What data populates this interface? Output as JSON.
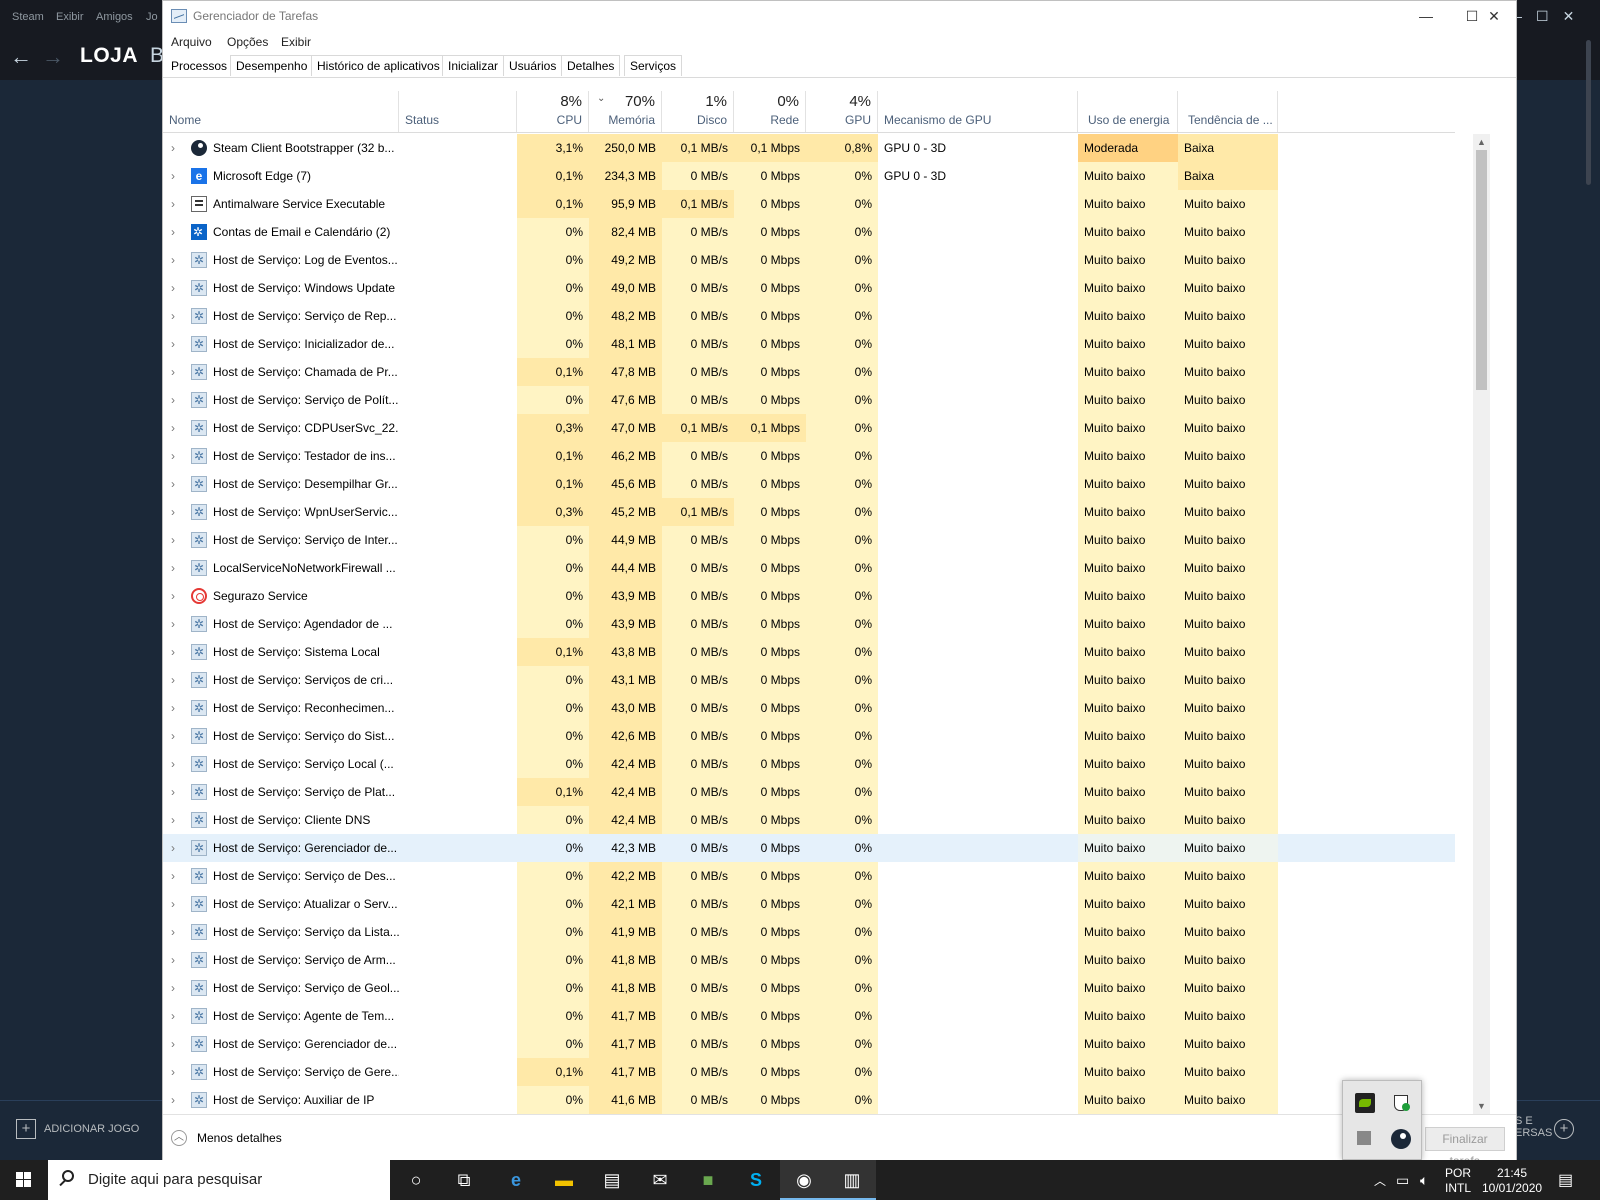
{
  "steam": {
    "menu": [
      "Steam",
      "Exibir",
      "Amigos",
      "Jo"
    ],
    "store_label": "LOJA",
    "store_next": "B",
    "add_game": "ADICIONAR JOGO",
    "friends_line1": "S E",
    "friends_line2": "ERSAS"
  },
  "taskmanager": {
    "title": "Gerenciador de Tarefas",
    "menu": [
      "Arquivo",
      "Opções",
      "Exibir"
    ],
    "tabs": [
      "Processos",
      "Desempenho",
      "Histórico de aplicativos",
      "Inicializar",
      "Usuários",
      "Detalhes",
      "Serviços"
    ],
    "active_tab": "Processos",
    "columns": {
      "name": "Nome",
      "status": "Status",
      "cpu": {
        "pct": "8%",
        "label": "CPU"
      },
      "memory": {
        "pct": "70%",
        "label": "Memória"
      },
      "disk": {
        "pct": "1%",
        "label": "Disco"
      },
      "network": {
        "pct": "0%",
        "label": "Rede"
      },
      "gpu": {
        "pct": "4%",
        "label": "GPU"
      },
      "gpu_engine": "Mecanismo de GPU",
      "power": "Uso de energia",
      "power_trend": "Tendência de ..."
    },
    "sorted_column": "Memória",
    "rows": [
      {
        "icon": "steam-icon",
        "name": "Steam Client Bootstrapper (32 b...",
        "cpu": "3,1%",
        "mem": "250,0 MB",
        "disk": "0,1 MB/s",
        "net": "0,1 Mbps",
        "gpu": "0,8%",
        "engine": "GPU 0 - 3D",
        "power": "Moderada",
        "trend": "Baixa"
      },
      {
        "icon": "edge-icon",
        "name": "Microsoft Edge (7)",
        "cpu": "0,1%",
        "mem": "234,3 MB",
        "disk": "0 MB/s",
        "net": "0 Mbps",
        "gpu": "0%",
        "engine": "GPU 0 - 3D",
        "power": "Muito baixo",
        "trend": "Baixa"
      },
      {
        "icon": "defender-icon",
        "name": "Antimalware Service Executable",
        "cpu": "0,1%",
        "mem": "95,9 MB",
        "disk": "0,1 MB/s",
        "net": "0 Mbps",
        "gpu": "0%",
        "engine": "",
        "power": "Muito baixo",
        "trend": "Muito baixo"
      },
      {
        "icon": "mail-icon",
        "name": "Contas de Email e Calendário (2)",
        "cpu": "0%",
        "mem": "82,4 MB",
        "disk": "0 MB/s",
        "net": "0 Mbps",
        "gpu": "0%",
        "engine": "",
        "power": "Muito baixo",
        "trend": "Muito baixo"
      },
      {
        "icon": "gear-icon",
        "name": "Host de Serviço: Log de Eventos...",
        "cpu": "0%",
        "mem": "49,2 MB",
        "disk": "0 MB/s",
        "net": "0 Mbps",
        "gpu": "0%",
        "engine": "",
        "power": "Muito baixo",
        "trend": "Muito baixo"
      },
      {
        "icon": "gear-icon",
        "name": "Host de Serviço: Windows Update",
        "cpu": "0%",
        "mem": "49,0 MB",
        "disk": "0 MB/s",
        "net": "0 Mbps",
        "gpu": "0%",
        "engine": "",
        "power": "Muito baixo",
        "trend": "Muito baixo"
      },
      {
        "icon": "gear-icon",
        "name": "Host de Serviço: Serviço de Rep...",
        "cpu": "0%",
        "mem": "48,2 MB",
        "disk": "0 MB/s",
        "net": "0 Mbps",
        "gpu": "0%",
        "engine": "",
        "power": "Muito baixo",
        "trend": "Muito baixo"
      },
      {
        "icon": "gear-icon",
        "name": "Host de Serviço: Inicializador de...",
        "cpu": "0%",
        "mem": "48,1 MB",
        "disk": "0 MB/s",
        "net": "0 Mbps",
        "gpu": "0%",
        "engine": "",
        "power": "Muito baixo",
        "trend": "Muito baixo"
      },
      {
        "icon": "gear-icon",
        "name": "Host de Serviço: Chamada de Pr...",
        "cpu": "0,1%",
        "mem": "47,8 MB",
        "disk": "0 MB/s",
        "net": "0 Mbps",
        "gpu": "0%",
        "engine": "",
        "power": "Muito baixo",
        "trend": "Muito baixo"
      },
      {
        "icon": "gear-icon",
        "name": "Host de Serviço: Serviço de Polít...",
        "cpu": "0%",
        "mem": "47,6 MB",
        "disk": "0 MB/s",
        "net": "0 Mbps",
        "gpu": "0%",
        "engine": "",
        "power": "Muito baixo",
        "trend": "Muito baixo"
      },
      {
        "icon": "gear-icon",
        "name": "Host de Serviço: CDPUserSvc_22...",
        "cpu": "0,3%",
        "mem": "47,0 MB",
        "disk": "0,1 MB/s",
        "net": "0,1 Mbps",
        "gpu": "0%",
        "engine": "",
        "power": "Muito baixo",
        "trend": "Muito baixo"
      },
      {
        "icon": "gear-icon",
        "name": "Host de Serviço: Testador de ins...",
        "cpu": "0,1%",
        "mem": "46,2 MB",
        "disk": "0 MB/s",
        "net": "0 Mbps",
        "gpu": "0%",
        "engine": "",
        "power": "Muito baixo",
        "trend": "Muito baixo"
      },
      {
        "icon": "gear-icon",
        "name": "Host de Serviço: Desempilhar Gr...",
        "cpu": "0,1%",
        "mem": "45,6 MB",
        "disk": "0 MB/s",
        "net": "0 Mbps",
        "gpu": "0%",
        "engine": "",
        "power": "Muito baixo",
        "trend": "Muito baixo"
      },
      {
        "icon": "gear-icon",
        "name": "Host de Serviço: WpnUserServic...",
        "cpu": "0,3%",
        "mem": "45,2 MB",
        "disk": "0,1 MB/s",
        "net": "0 Mbps",
        "gpu": "0%",
        "engine": "",
        "power": "Muito baixo",
        "trend": "Muito baixo"
      },
      {
        "icon": "gear-icon",
        "name": "Host de Serviço: Serviço de Inter...",
        "cpu": "0%",
        "mem": "44,9 MB",
        "disk": "0 MB/s",
        "net": "0 Mbps",
        "gpu": "0%",
        "engine": "",
        "power": "Muito baixo",
        "trend": "Muito baixo"
      },
      {
        "icon": "gear-icon",
        "name": "LocalServiceNoNetworkFirewall ...",
        "cpu": "0%",
        "mem": "44,4 MB",
        "disk": "0 MB/s",
        "net": "0 Mbps",
        "gpu": "0%",
        "engine": "",
        "power": "Muito baixo",
        "trend": "Muito baixo"
      },
      {
        "icon": "segurazo-icon",
        "name": "Segurazo Service",
        "cpu": "0%",
        "mem": "43,9 MB",
        "disk": "0 MB/s",
        "net": "0 Mbps",
        "gpu": "0%",
        "engine": "",
        "power": "Muito baixo",
        "trend": "Muito baixo"
      },
      {
        "icon": "gear-icon",
        "name": "Host de Serviço: Agendador de ...",
        "cpu": "0%",
        "mem": "43,9 MB",
        "disk": "0 MB/s",
        "net": "0 Mbps",
        "gpu": "0%",
        "engine": "",
        "power": "Muito baixo",
        "trend": "Muito baixo"
      },
      {
        "icon": "gear-icon",
        "name": "Host de Serviço: Sistema Local",
        "cpu": "0,1%",
        "mem": "43,8 MB",
        "disk": "0 MB/s",
        "net": "0 Mbps",
        "gpu": "0%",
        "engine": "",
        "power": "Muito baixo",
        "trend": "Muito baixo"
      },
      {
        "icon": "gear-icon",
        "name": "Host de Serviço: Serviços de cri...",
        "cpu": "0%",
        "mem": "43,1 MB",
        "disk": "0 MB/s",
        "net": "0 Mbps",
        "gpu": "0%",
        "engine": "",
        "power": "Muito baixo",
        "trend": "Muito baixo"
      },
      {
        "icon": "gear-icon",
        "name": "Host de Serviço: Reconhecimen...",
        "cpu": "0%",
        "mem": "43,0 MB",
        "disk": "0 MB/s",
        "net": "0 Mbps",
        "gpu": "0%",
        "engine": "",
        "power": "Muito baixo",
        "trend": "Muito baixo"
      },
      {
        "icon": "gear-icon",
        "name": "Host de Serviço: Serviço do Sist...",
        "cpu": "0%",
        "mem": "42,6 MB",
        "disk": "0 MB/s",
        "net": "0 Mbps",
        "gpu": "0%",
        "engine": "",
        "power": "Muito baixo",
        "trend": "Muito baixo"
      },
      {
        "icon": "gear-icon",
        "name": "Host de Serviço: Serviço Local (...",
        "cpu": "0%",
        "mem": "42,4 MB",
        "disk": "0 MB/s",
        "net": "0 Mbps",
        "gpu": "0%",
        "engine": "",
        "power": "Muito baixo",
        "trend": "Muito baixo"
      },
      {
        "icon": "gear-icon",
        "name": "Host de Serviço: Serviço de Plat...",
        "cpu": "0,1%",
        "mem": "42,4 MB",
        "disk": "0 MB/s",
        "net": "0 Mbps",
        "gpu": "0%",
        "engine": "",
        "power": "Muito baixo",
        "trend": "Muito baixo"
      },
      {
        "icon": "gear-icon",
        "name": "Host de Serviço: Cliente DNS",
        "cpu": "0%",
        "mem": "42,4 MB",
        "disk": "0 MB/s",
        "net": "0 Mbps",
        "gpu": "0%",
        "engine": "",
        "power": "Muito baixo",
        "trend": "Muito baixo"
      },
      {
        "icon": "gear-icon",
        "name": "Host de Serviço: Gerenciador de...",
        "cpu": "0%",
        "mem": "42,3 MB",
        "disk": "0 MB/s",
        "net": "0 Mbps",
        "gpu": "0%",
        "engine": "",
        "power": "Muito baixo",
        "trend": "Muito baixo",
        "selected": true
      },
      {
        "icon": "gear-icon",
        "name": "Host de Serviço: Serviço de Des...",
        "cpu": "0%",
        "mem": "42,2 MB",
        "disk": "0 MB/s",
        "net": "0 Mbps",
        "gpu": "0%",
        "engine": "",
        "power": "Muito baixo",
        "trend": "Muito baixo"
      },
      {
        "icon": "gear-icon",
        "name": "Host de Serviço: Atualizar o Serv...",
        "cpu": "0%",
        "mem": "42,1 MB",
        "disk": "0 MB/s",
        "net": "0 Mbps",
        "gpu": "0%",
        "engine": "",
        "power": "Muito baixo",
        "trend": "Muito baixo"
      },
      {
        "icon": "gear-icon",
        "name": "Host de Serviço: Serviço da Lista...",
        "cpu": "0%",
        "mem": "41,9 MB",
        "disk": "0 MB/s",
        "net": "0 Mbps",
        "gpu": "0%",
        "engine": "",
        "power": "Muito baixo",
        "trend": "Muito baixo"
      },
      {
        "icon": "gear-icon",
        "name": "Host de Serviço: Serviço de Arm...",
        "cpu": "0%",
        "mem": "41,8 MB",
        "disk": "0 MB/s",
        "net": "0 Mbps",
        "gpu": "0%",
        "engine": "",
        "power": "Muito baixo",
        "trend": "Muito baixo"
      },
      {
        "icon": "gear-icon",
        "name": "Host de Serviço: Serviço de Geol...",
        "cpu": "0%",
        "mem": "41,8 MB",
        "disk": "0 MB/s",
        "net": "0 Mbps",
        "gpu": "0%",
        "engine": "",
        "power": "Muito baixo",
        "trend": "Muito baixo"
      },
      {
        "icon": "gear-icon",
        "name": "Host de Serviço: Agente de Tem...",
        "cpu": "0%",
        "mem": "41,7 MB",
        "disk": "0 MB/s",
        "net": "0 Mbps",
        "gpu": "0%",
        "engine": "",
        "power": "Muito baixo",
        "trend": "Muito baixo"
      },
      {
        "icon": "gear-icon",
        "name": "Host de Serviço: Gerenciador de...",
        "cpu": "0%",
        "mem": "41,7 MB",
        "disk": "0 MB/s",
        "net": "0 Mbps",
        "gpu": "0%",
        "engine": "",
        "power": "Muito baixo",
        "trend": "Muito baixo"
      },
      {
        "icon": "gear-icon",
        "name": "Host de Serviço: Serviço de Gere...",
        "cpu": "0,1%",
        "mem": "41,7 MB",
        "disk": "0 MB/s",
        "net": "0 Mbps",
        "gpu": "0%",
        "engine": "",
        "power": "Muito baixo",
        "trend": "Muito baixo"
      },
      {
        "icon": "gear-icon",
        "name": "Host de Serviço: Auxiliar de IP",
        "cpu": "0%",
        "mem": "41,6 MB",
        "disk": "0 MB/s",
        "net": "0 Mbps",
        "gpu": "0%",
        "engine": "",
        "power": "Muito baixo",
        "trend": "Muito baixo"
      }
    ],
    "footer": {
      "less_details": "Menos detalhes",
      "end_task": "Finalizar tarefa"
    },
    "colors": {
      "heat_light": "#fff4c4",
      "heat_medium": "#ffe9a8",
      "heat_moderate": "#ffd282",
      "selected": "#e5f1fb"
    }
  },
  "taskbar": {
    "search_placeholder": "Digite aqui para pesquisar",
    "lang_line1": "POR",
    "lang_line2": "INTL",
    "time": "21:45",
    "date": "10/01/2020"
  }
}
